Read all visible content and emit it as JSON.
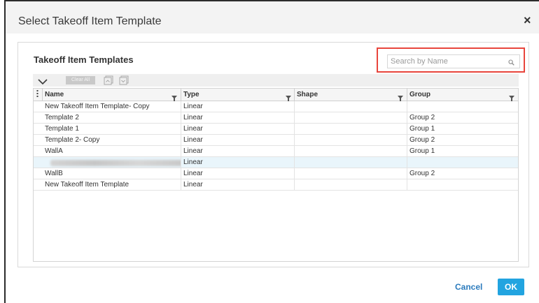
{
  "dialog": {
    "title": "Select Takeoff Item Template",
    "close_symbol": "×"
  },
  "panel": {
    "title": "Takeoff Item Templates",
    "search_placeholder": "Search by Name"
  },
  "toolbar": {
    "clear_all_label": "Clear All"
  },
  "grid": {
    "columns": [
      {
        "label": "Name"
      },
      {
        "label": "Type"
      },
      {
        "label": "Shape"
      },
      {
        "label": "Group"
      }
    ],
    "rows": [
      {
        "name": "New Takeoff Item Template- Copy",
        "type": "Linear",
        "shape": "",
        "group": ""
      },
      {
        "name": "Template 2",
        "type": "Linear",
        "shape": "",
        "group": "Group 2"
      },
      {
        "name": "Template 1",
        "type": "Linear",
        "shape": "",
        "group": "Group 1"
      },
      {
        "name": "Template 2- Copy",
        "type": "Linear",
        "shape": "",
        "group": "Group 2"
      },
      {
        "name": "WallA",
        "type": "Linear",
        "shape": "",
        "group": "Group 1"
      },
      {
        "name": "",
        "type": "Linear",
        "shape": "",
        "group": "",
        "selected": true,
        "name_blurred": true
      },
      {
        "name": "WallB",
        "type": "Linear",
        "shape": "",
        "group": "Group 2"
      },
      {
        "name": "New Takeoff Item Template",
        "type": "Linear",
        "shape": "",
        "group": ""
      }
    ]
  },
  "footer": {
    "cancel_label": "Cancel",
    "ok_label": "OK"
  },
  "colors": {
    "accent": "#22a4e0",
    "link": "#2b7bbd",
    "highlight_border": "#e8453c",
    "selected_row": "#e9f5fb"
  }
}
